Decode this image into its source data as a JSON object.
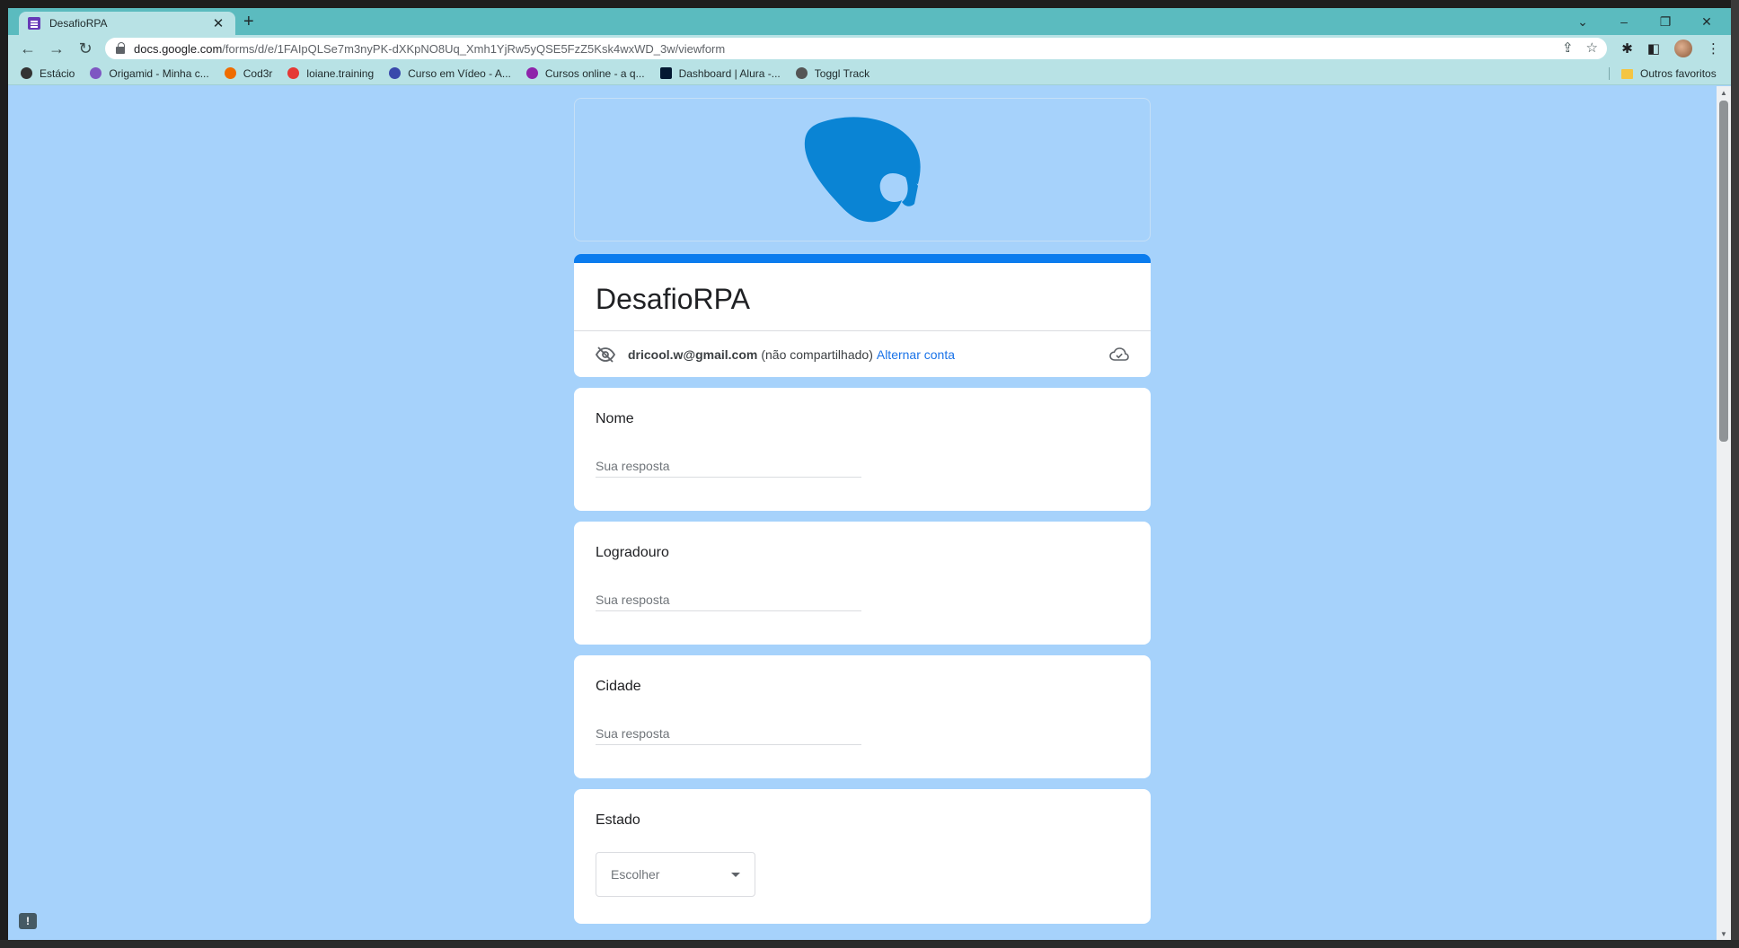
{
  "browser": {
    "tab_title": "DesafioRPA",
    "tab_close": "✕",
    "new_tab": "+",
    "url_host": "docs.google.com",
    "url_path": "/forms/d/e/1FAIpQLSe7m3nyPK-dXKpNO8Uq_Xmh1YjRw5yQSE5FzZ5Ksk4wxWD_3w/viewform",
    "bookmarks": [
      {
        "label": "Estácio",
        "color": "#333333"
      },
      {
        "label": "Origamid - Minha c...",
        "color": "#7e57c2"
      },
      {
        "label": "Cod3r",
        "color": "#ef6c00"
      },
      {
        "label": "loiane.training",
        "color": "#e53935"
      },
      {
        "label": "Curso em Vídeo - A...",
        "color": "#3949ab"
      },
      {
        "label": "Cursos online - a q...",
        "color": "#8e24aa"
      },
      {
        "label": "Dashboard | Alura -...",
        "color": "#051933"
      },
      {
        "label": "Toggl Track",
        "color": "#555555"
      }
    ],
    "other_bookmarks": "Outros favoritos"
  },
  "form": {
    "title": "DesafioRPA",
    "account_email": "dricool.w@gmail.com",
    "account_note": "(não compartilhado)",
    "switch_account": "Alternar conta",
    "questions": [
      {
        "label": "Nome",
        "placeholder": "Sua resposta"
      },
      {
        "label": "Logradouro",
        "placeholder": "Sua resposta"
      },
      {
        "label": "Cidade",
        "placeholder": "Sua resposta"
      }
    ],
    "select_question": {
      "label": "Estado",
      "selected": "Escolher"
    }
  },
  "colors": {
    "background": "#a6d2fb",
    "accent": "#0b7cee",
    "logo": "#0a84d4"
  }
}
